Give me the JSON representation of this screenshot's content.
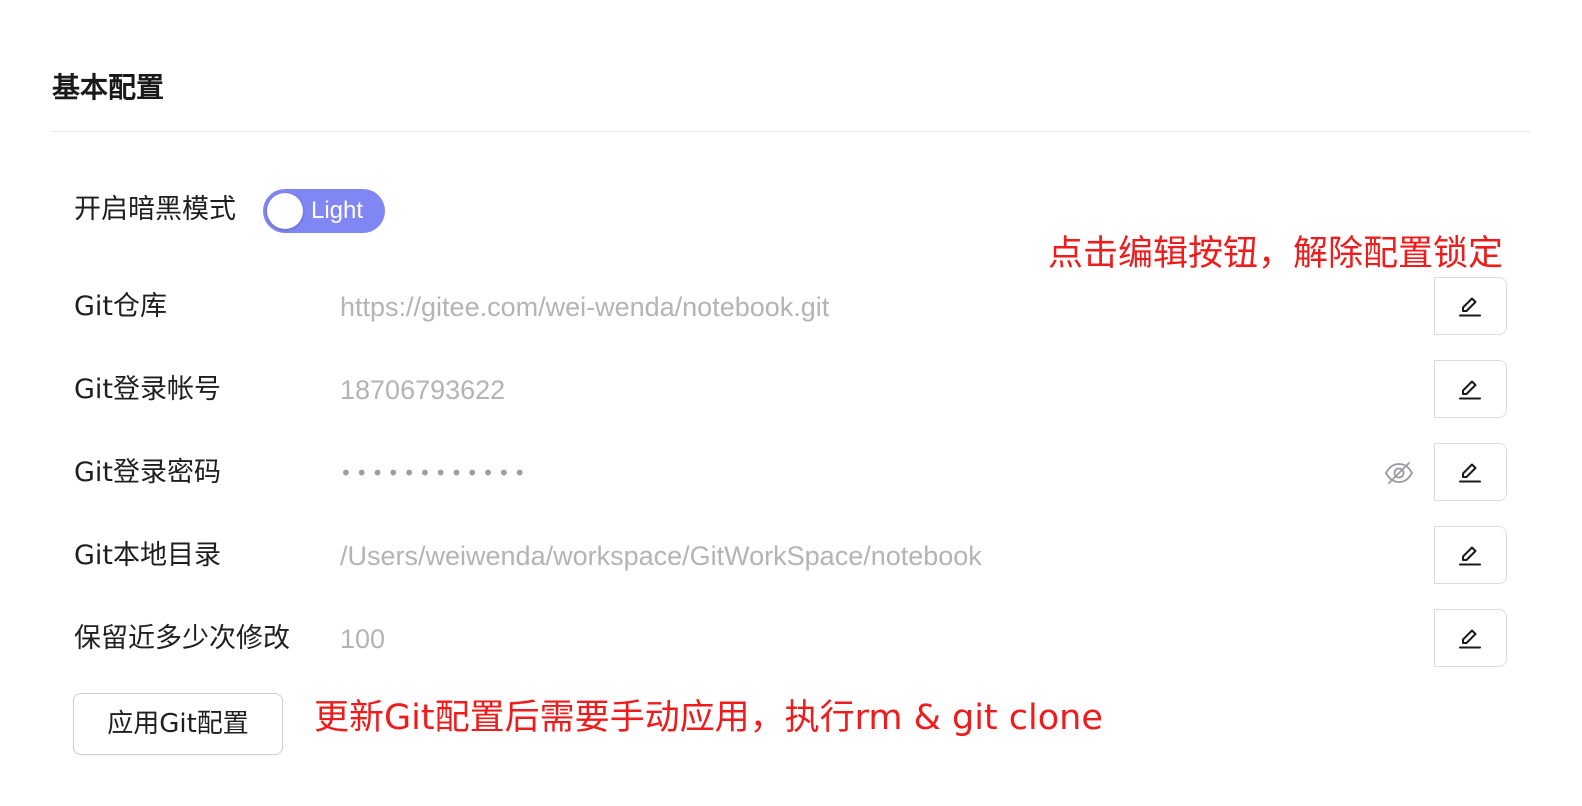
{
  "section": {
    "title": "基本配置"
  },
  "dark_mode": {
    "label": "开启暗黑模式",
    "toggle_text": "Light",
    "enabled": false,
    "toggle_color": "#8186f5"
  },
  "annotations": {
    "edit_hint": "点击编辑按钮，解除配置锁定",
    "apply_hint": "更新Git配置后需要手动应用，执行rm & git clone",
    "color": "#ee1c1c"
  },
  "fields": [
    {
      "label": "Git仓库",
      "value": "https://gitee.com/wei-wenda/notebook.git",
      "edit_icon": "pencil-icon"
    },
    {
      "label": "Git登录帐号",
      "value": "18706793622",
      "edit_icon": "pencil-icon"
    },
    {
      "label": "Git登录密码",
      "value": "••••••••••••",
      "visibility_icon": "eye-off-icon",
      "edit_icon": "pencil-icon"
    },
    {
      "label": "Git本地目录",
      "value": "/Users/weiwenda/workspace/GitWorkSpace/notebook",
      "edit_icon": "pencil-icon"
    },
    {
      "label": "保留近多少次修改",
      "value": "100",
      "edit_icon": "pencil-icon"
    }
  ],
  "apply_button": {
    "label": "应用Git配置"
  }
}
